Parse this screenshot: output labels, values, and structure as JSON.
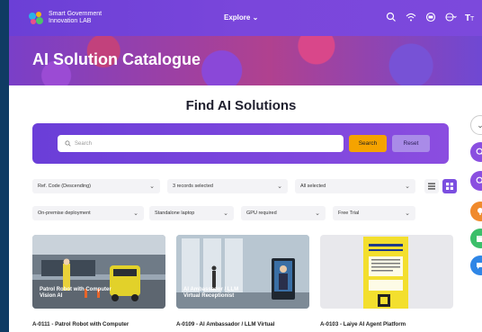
{
  "brand": {
    "logo_line1": "Smart Government",
    "logo_line2": "Innovation LAB"
  },
  "nav": {
    "explore_label": "Explore ⌄",
    "icons": [
      "search-icon",
      "wifi-icon",
      "printer-icon",
      "globe-icon",
      "text-size-icon"
    ]
  },
  "hero": {
    "title": "AI Solution Catalogue"
  },
  "find": {
    "title": "Find AI Solutions",
    "search_placeholder": "Search",
    "search_label": "Search",
    "reset_label": "Reset"
  },
  "filters": {
    "sort": "Ref. Code (Descending)",
    "records": "3 records selected",
    "all": "All selected",
    "deployment": "On-premise deployment",
    "device": "Standalone laptop",
    "gpu": "GPU required",
    "trial": "Free Trial"
  },
  "cards": [
    {
      "overlay": "Patrol Robot with Computer Vision AI",
      "caption": "A-0111 - Patrol Robot with Computer"
    },
    {
      "overlay": "AI Ambassador / LLM Virtual Receptionist",
      "caption": "A-0109 - AI Ambassador / LLM Virtual"
    },
    {
      "overlay": "",
      "caption": "A-0103 - Laiye AI Agent Platform"
    }
  ],
  "colors": {
    "nav": "#7a46db",
    "accent_orange": "#f5a300",
    "panel_start": "#6a3ed8",
    "panel_end": "#8b4de0"
  }
}
